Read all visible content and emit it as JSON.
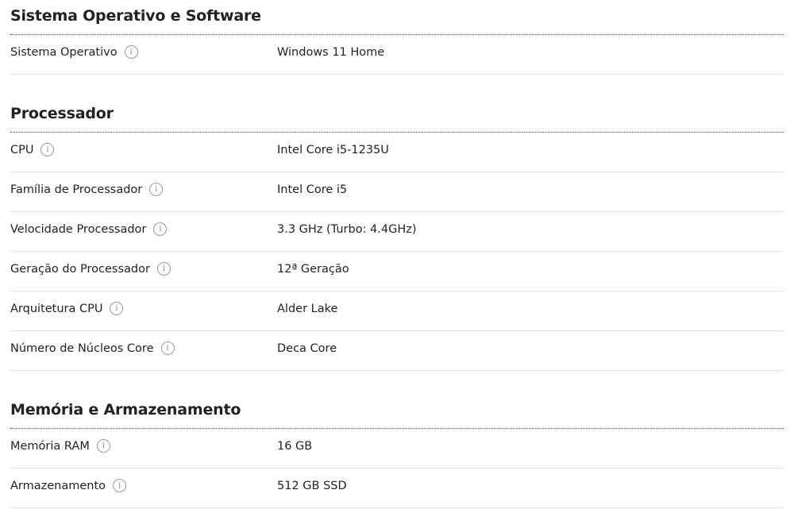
{
  "sections": [
    {
      "title": "Sistema Operativo e Software",
      "rows": [
        {
          "label": "Sistema Operativo",
          "value": "Windows 11 Home"
        }
      ]
    },
    {
      "title": "Processador",
      "rows": [
        {
          "label": "CPU",
          "value": "Intel Core i5-1235U"
        },
        {
          "label": "Família de Processador",
          "value": "Intel Core i5"
        },
        {
          "label": "Velocidade Processador",
          "value": "3.3 GHz (Turbo: 4.4GHz)"
        },
        {
          "label": "Geração do Processador",
          "value": "12ª Geração"
        },
        {
          "label": "Arquitetura CPU",
          "value": "Alder Lake"
        },
        {
          "label": "Número de Núcleos Core",
          "value": "Deca Core"
        }
      ]
    },
    {
      "title": "Memória e Armazenamento",
      "rows": [
        {
          "label": "Memória RAM",
          "value": "16 GB"
        },
        {
          "label": "Armazenamento",
          "value": "512 GB SSD"
        }
      ]
    }
  ],
  "icons": {
    "info": "info-circle-icon",
    "glyph": "i"
  }
}
